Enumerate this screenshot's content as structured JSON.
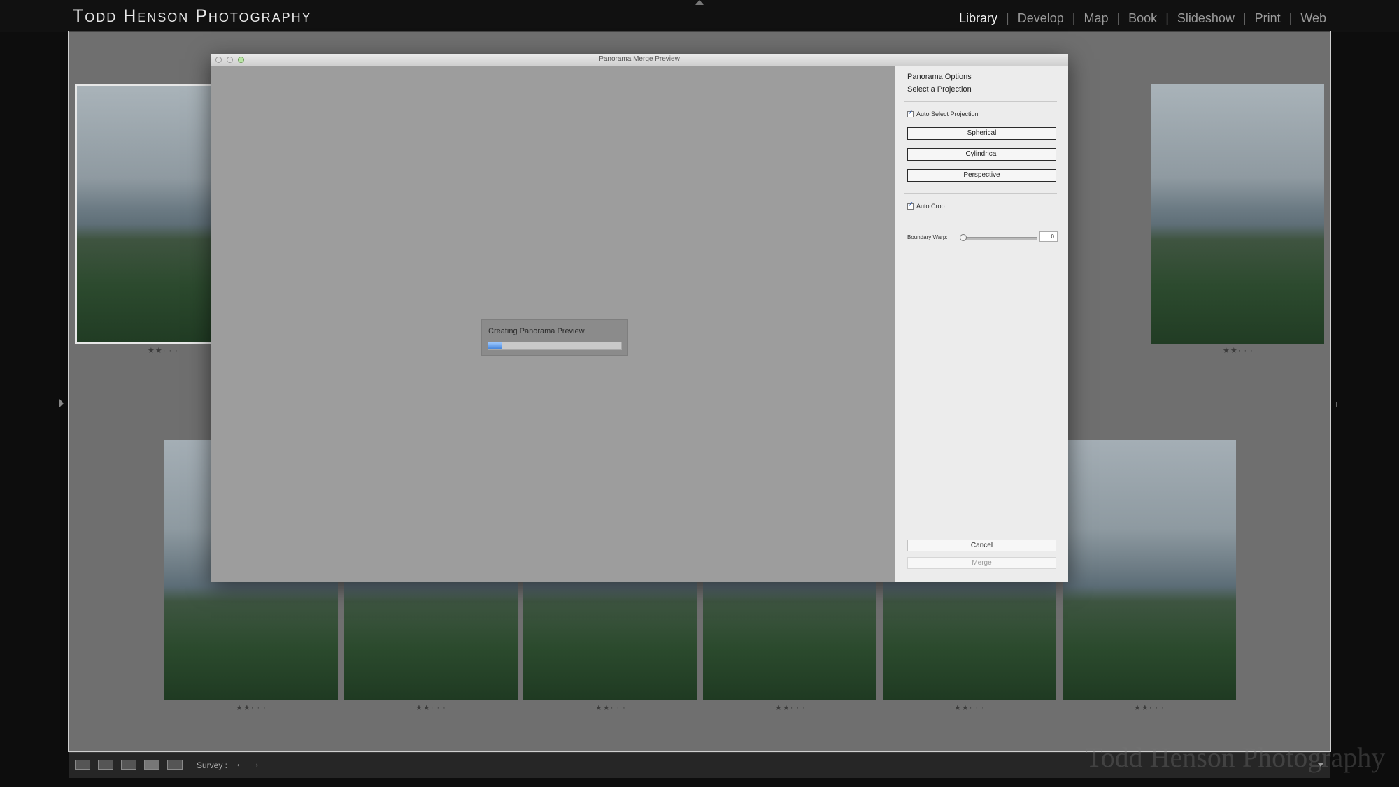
{
  "identity_plate": "Todd Henson Photography",
  "modules": [
    "Library",
    "Develop",
    "Map",
    "Book",
    "Slideshow",
    "Print",
    "Web"
  ],
  "active_module": "Library",
  "grid": {
    "thumbnails": [
      {
        "rating": "★★· · ·",
        "selected": true
      },
      {
        "rating": "★★· · ·"
      },
      {
        "rating": "★★· · ·"
      },
      {
        "rating": "★★· · ·"
      },
      {
        "rating": "★★· · ·"
      },
      {
        "rating": "★★· · ·"
      },
      {
        "rating": "★★· · ·"
      },
      {
        "rating": "★★· · ·"
      },
      {
        "rating": "★★· · ·"
      }
    ]
  },
  "toolbar": {
    "view_icons": [
      "grid-view-icon",
      "loupe-view-icon",
      "compare-view-icon",
      "survey-view-icon",
      "people-view-icon"
    ],
    "mode_label": "Survey :",
    "prev_arrow": "←",
    "next_arrow": "→"
  },
  "watermark": "Todd Henson Photography",
  "dialog": {
    "title": "Panorama Merge Preview",
    "progress": {
      "label": "Creating Panorama Preview",
      "fraction": 0.1
    },
    "options": {
      "heading": "Panorama Options",
      "subheading": "Select a Projection",
      "auto_select_projection": {
        "label": "Auto Select Projection",
        "checked": true
      },
      "projections": [
        "Spherical",
        "Cylindrical",
        "Perspective"
      ],
      "auto_crop": {
        "label": "Auto Crop",
        "checked": true
      },
      "boundary_warp": {
        "label": "Boundary Warp:",
        "value": "0"
      }
    },
    "cancel_label": "Cancel",
    "merge_label": "Merge"
  },
  "colors": {
    "progress_fill": "#3e7fd8",
    "active_module": "#f2f2f2",
    "inactive_module": "#9a9a9a"
  }
}
